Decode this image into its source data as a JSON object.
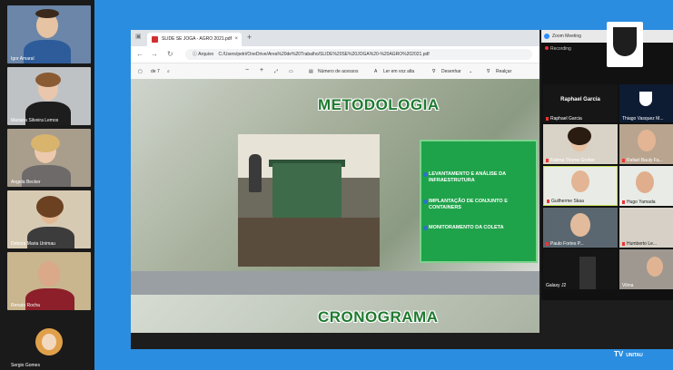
{
  "left_participants": [
    {
      "name": "Igor Amaral"
    },
    {
      "name": "Mariana Silveira Lemos"
    },
    {
      "name": "Angela Becker"
    },
    {
      "name": "Debora Maria Unimau"
    },
    {
      "name": "Renato Rocha"
    },
    {
      "name": "Sergio Gomes"
    }
  ],
  "browser": {
    "tab_title": "SLIDE SE JOGA - AGRO 2021.pdf",
    "tab_close": "×",
    "new_tab": "+",
    "url_prefix": "Arquivo",
    "url": "C:/Users/petri/OneDrive/Area%20de%20Trabalho/SLIDE%20SE%20JOGA%20-%20AGRO%202021.pdf"
  },
  "pdf_toolbar": {
    "page": "de 7",
    "zoom_out": "−",
    "zoom_in": "+",
    "access_numbers": "Número de acessos",
    "read_aloud": "Ler em voz alta",
    "draw": "Desenhar",
    "highlight": "Realçar"
  },
  "slide": {
    "title": "METODOLOGIA",
    "items": [
      "LEVANTAMENTO E ANÁLISE DA INFRAESTRUTURA",
      "IMPLANTAÇÃO DE CONJUNTO E CONTAINERS",
      "MONITORAMENTO DA COLETA"
    ],
    "next_title": "CRONOGRAMA"
  },
  "zoom": {
    "window_title": "Zoom Meeting",
    "recording": "Recording",
    "speaker": "Raphael Garcia",
    "participants": [
      {
        "name": "Raphael Garcia"
      },
      {
        "name": "Thiago Vasquez M..."
      },
      {
        "name": "Fatima Thome Grober"
      },
      {
        "name": "Rafael Bauly Fa..."
      },
      {
        "name": "Guilherme Skaa"
      },
      {
        "name": "Hugo Yamada"
      },
      {
        "name": "Paulo Fortes P..."
      },
      {
        "name": "Humberto Le..."
      },
      {
        "name": "Galaxy J2"
      },
      {
        "name": "Vilma"
      }
    ]
  },
  "watermark": {
    "tv": "TV",
    "brand": "UNITAU"
  }
}
